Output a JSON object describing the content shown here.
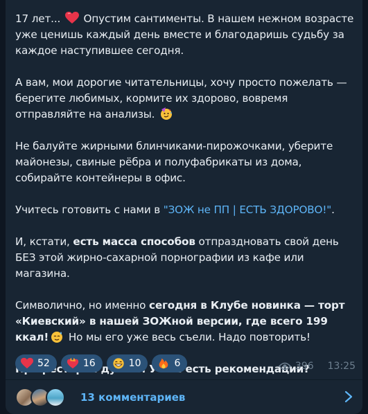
{
  "post": {
    "paragraphs": [
      {
        "p1_a": "17 лет... ",
        "p1_b": " Опустим сантименты. В нашем нежном возрасте уже ценишь каждый день вместе и благодаришь судьбу за каждое наступившее сегодня."
      },
      {
        "p2_a": "А вам, мои дорогие читательницы, хочу просто пожелать — берегите любимых, кормите их здорово, вовремя отправляйте на анализы. "
      },
      {
        "p3_a": "Не балуйте жирными блинчиками-пирожочками, уберите майонезы, свиные рёбра и полуфабрикаты из дома, собирайте контейнеры в офис."
      },
      {
        "p4_a": "Учитесь готовить с нами в ",
        "p4_link": "\"ЗОЖ не ПП | ЕСТЬ ЗДОРОВО!\"",
        "p4_b": "."
      },
      {
        "p5_a": "И, кстати, ",
        "p5_bold": "есть масса способов",
        "p5_b": " отпраздновать свой день БЕЗ этой жирно-сахарной порнографии из кафе или магазина."
      },
      {
        "p6_a": "Символично, но именно ",
        "p6_bold": "сегодня в Клубе новинка — торт «Киевский» в нашей ЗОЖной версии, где всего 199 ккал!",
        "p6_b": " Но мы его уже весь съели. Надо повторить!"
      },
      {
        "p7_bold": "Про ресторан думаю. У Вас есть рекомендации?"
      }
    ],
    "emojis": {
      "heart": "red-heart-emoji",
      "party": "partying-face-emoji",
      "sweat": "relieved-sweat-emoji"
    }
  },
  "reactions": [
    {
      "icon": "heart-emoji",
      "count": "52"
    },
    {
      "icon": "heart-on-fire-emoji",
      "count": "16"
    },
    {
      "icon": "grinning-face-emoji",
      "count": "10"
    },
    {
      "icon": "fire-emoji",
      "count": "6"
    }
  ],
  "meta": {
    "views": "396",
    "time": "13:25"
  },
  "comments": {
    "label": "13 комментариев"
  },
  "colors": {
    "bg": "#0e1621",
    "bubble": "#182533",
    "link": "#5eb5f7",
    "chip": "#2b5278",
    "muted": "#6d7f8f"
  }
}
